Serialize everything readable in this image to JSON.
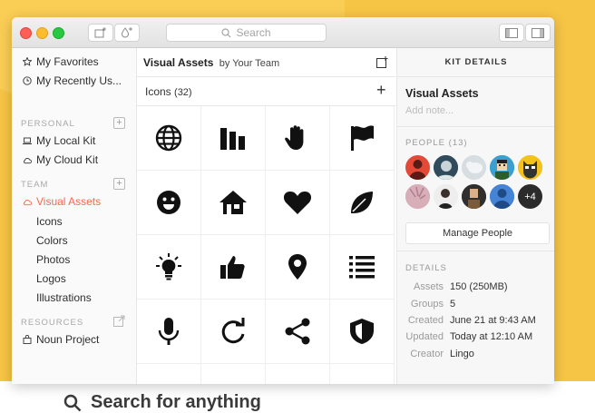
{
  "window": {
    "search_placeholder": "Search"
  },
  "sidebar": {
    "top_items": [
      {
        "label": "My Favorites",
        "icon": "star-icon"
      },
      {
        "label": "My Recently Us...",
        "icon": "clock-icon"
      }
    ],
    "sections": {
      "personal": "PERSONAL",
      "team": "TEAM",
      "resources": "RESOURCES"
    },
    "personal_items": [
      {
        "label": "My Local Kit",
        "icon": "laptop-icon"
      },
      {
        "label": "My Cloud Kit",
        "icon": "cloud-icon"
      }
    ],
    "team_kit": {
      "label": "Visual Assets",
      "icon": "cloud-icon",
      "color": "#f26c4f"
    },
    "team_sub_items": [
      "Icons",
      "Colors",
      "Photos",
      "Logos",
      "Illustrations"
    ],
    "resource_items": [
      {
        "label": "Noun Project",
        "icon": "bag-icon"
      }
    ]
  },
  "center": {
    "kit_title": "Visual Assets",
    "kit_owner": "by Your Team",
    "section_label": "Icons",
    "section_count": "(32)",
    "icons": [
      "globe-icon",
      "bar-chart-icon",
      "hand-icon",
      "flag-icon",
      "smiley-icon",
      "house-icon",
      "heart-icon",
      "leaf-icon",
      "lightbulb-icon",
      "thumbs-up-icon",
      "map-pin-icon",
      "list-icon",
      "microphone-icon",
      "refresh-icon",
      "share-icon",
      "shield-icon"
    ]
  },
  "details_panel": {
    "header": "KIT DETAILS",
    "title": "Visual Assets",
    "note_placeholder": "Add note...",
    "people_label": "PEOPLE (13)",
    "more_people": "+4",
    "manage_people": "Manage People",
    "details_label": "DETAILS",
    "details": [
      {
        "key": "Assets",
        "value": "150 (250MB)"
      },
      {
        "key": "Groups",
        "value": "5"
      },
      {
        "key": "Created",
        "value": "June 21 at 9:43 AM"
      },
      {
        "key": "Updated",
        "value": "Today at 12:10 AM"
      },
      {
        "key": "Creator",
        "value": "Lingo"
      }
    ]
  },
  "footer": {
    "search_text": "Search for anything"
  },
  "colors": {
    "accent": "#f26c4f",
    "background": "#f7c545"
  }
}
